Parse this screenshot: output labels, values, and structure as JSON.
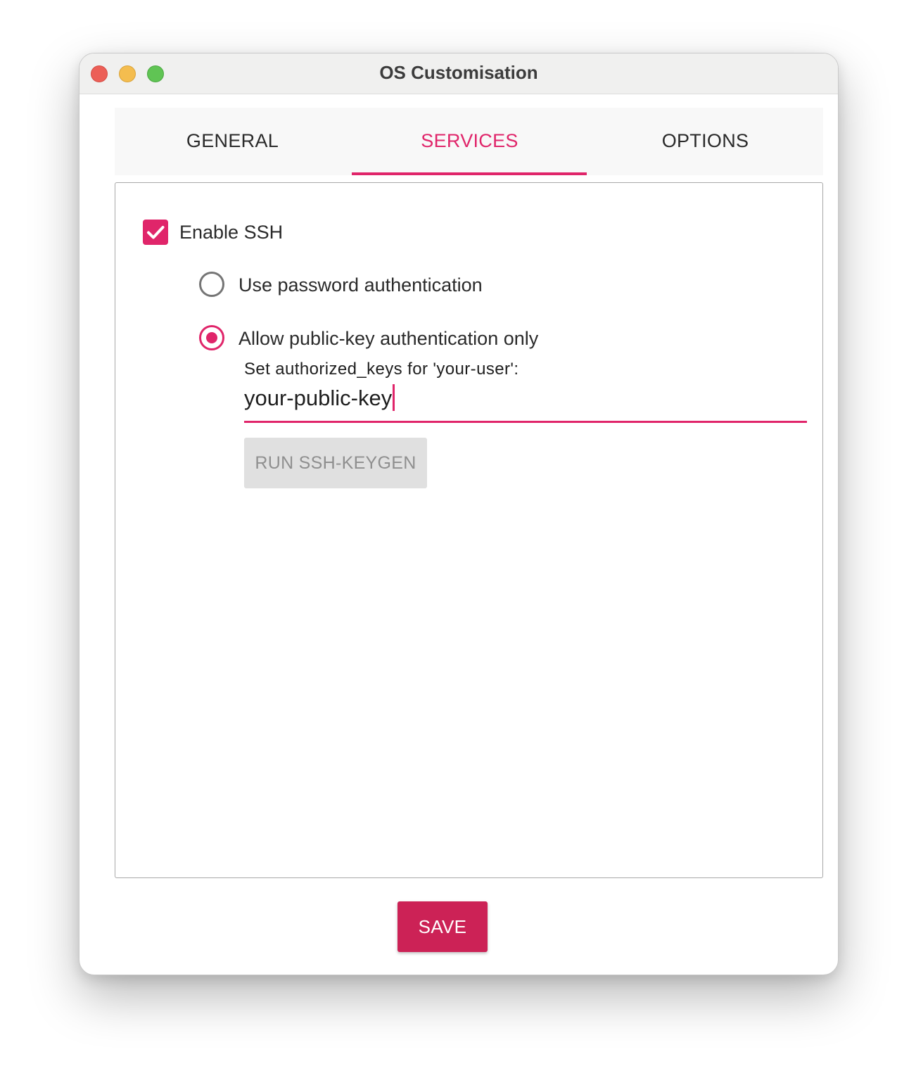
{
  "window": {
    "title": "OS Customisation"
  },
  "tabs": {
    "items": [
      {
        "label": "GENERAL"
      },
      {
        "label": "SERVICES"
      },
      {
        "label": "OPTIONS"
      }
    ],
    "active": "SERVICES"
  },
  "services": {
    "enable_ssh": {
      "label": "Enable SSH",
      "checked": true
    },
    "auth_options": [
      {
        "label": "Use password authentication",
        "selected": false
      },
      {
        "label": "Allow public-key authentication only",
        "selected": true
      }
    ],
    "authorized_keys": {
      "label": "Set authorized_keys for 'your-user':",
      "value": "your-public-key"
    },
    "keygen_button": {
      "label": "RUN SSH-KEYGEN"
    }
  },
  "footer": {
    "save_label": "SAVE"
  },
  "colors": {
    "accent": "#e0256a",
    "save_button": "#cc2256",
    "disabled_button": "#e0e0e0"
  },
  "icons": [
    "close-window-icon",
    "minimize-window-icon",
    "zoom-window-icon",
    "checkmark-icon"
  ]
}
